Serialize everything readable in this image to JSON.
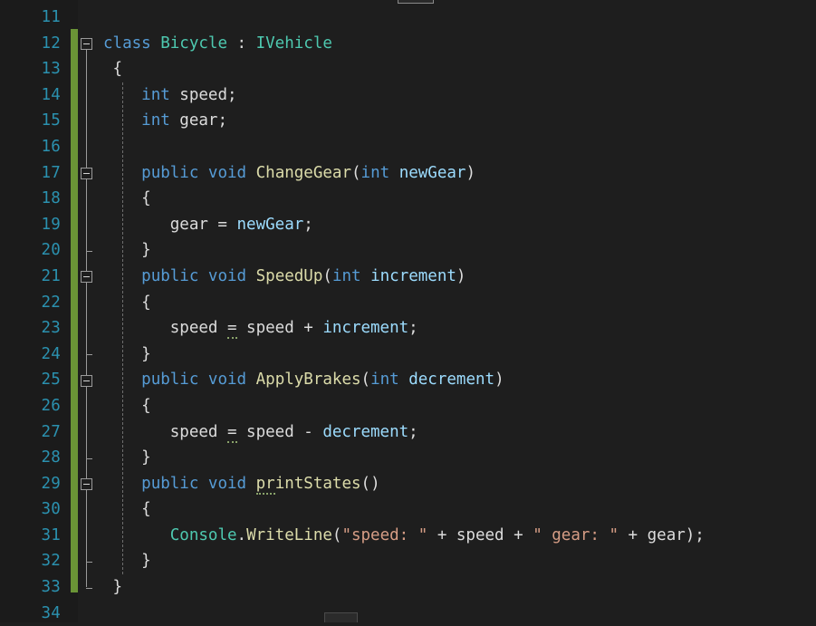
{
  "editor": {
    "language": "csharp",
    "first_visible_line": 11,
    "last_visible_line": 34,
    "colors": {
      "background": "#1e1e1e",
      "gutter_background": "#1b1b1b",
      "line_number": "#2b91af",
      "change_bar": "#6a9436",
      "keyword": "#569cd6",
      "type": "#4ec9b0",
      "method": "#dcdcaa",
      "parameter": "#9cdcfe",
      "string": "#d69d85",
      "plain": "#dcdcdc",
      "fold_marker": "#9a9a9a",
      "indent_guide": "#6e6e6e",
      "hint_underline": "#8aa36a"
    }
  },
  "line_numbers": [
    11,
    12,
    13,
    14,
    15,
    16,
    17,
    18,
    19,
    20,
    21,
    22,
    23,
    24,
    25,
    26,
    27,
    28,
    29,
    30,
    31,
    32,
    33,
    34
  ],
  "fold_markers": [
    {
      "line": 12,
      "state": "expanded",
      "glyph": "minus-box"
    },
    {
      "line": 17,
      "state": "expanded",
      "glyph": "minus-box"
    },
    {
      "line": 21,
      "state": "expanded",
      "glyph": "minus-box"
    },
    {
      "line": 25,
      "state": "expanded",
      "glyph": "minus-box"
    },
    {
      "line": 29,
      "state": "expanded",
      "glyph": "minus-box"
    }
  ],
  "code_lines": [
    {
      "n": 11,
      "tokens": []
    },
    {
      "n": 12,
      "tokens": [
        {
          "t": "class",
          "c": "kw"
        },
        {
          "t": " ",
          "c": "pln"
        },
        {
          "t": "Bicycle",
          "c": "type"
        },
        {
          "t": " : ",
          "c": "pln"
        },
        {
          "t": "IVehicle",
          "c": "type"
        }
      ]
    },
    {
      "n": 13,
      "tokens": [
        {
          "t": " {",
          "c": "pln"
        }
      ]
    },
    {
      "n": 14,
      "tokens": [
        {
          "t": "    ",
          "c": "pln"
        },
        {
          "t": "int",
          "c": "kw"
        },
        {
          "t": " speed;",
          "c": "pln"
        }
      ]
    },
    {
      "n": 15,
      "tokens": [
        {
          "t": "    ",
          "c": "pln"
        },
        {
          "t": "int",
          "c": "kw"
        },
        {
          "t": " gear;",
          "c": "pln"
        }
      ]
    },
    {
      "n": 16,
      "tokens": []
    },
    {
      "n": 17,
      "tokens": [
        {
          "t": "    ",
          "c": "pln"
        },
        {
          "t": "public",
          "c": "kw"
        },
        {
          "t": " ",
          "c": "pln"
        },
        {
          "t": "void",
          "c": "kw"
        },
        {
          "t": " ",
          "c": "pln"
        },
        {
          "t": "ChangeGear",
          "c": "mth"
        },
        {
          "t": "(",
          "c": "pln"
        },
        {
          "t": "int",
          "c": "kw"
        },
        {
          "t": " ",
          "c": "pln"
        },
        {
          "t": "newGear",
          "c": "par"
        },
        {
          "t": ")",
          "c": "pln"
        }
      ]
    },
    {
      "n": 18,
      "tokens": [
        {
          "t": "    {",
          "c": "pln"
        }
      ]
    },
    {
      "n": 19,
      "tokens": [
        {
          "t": "       gear = ",
          "c": "pln"
        },
        {
          "t": "newGear",
          "c": "par"
        },
        {
          "t": ";",
          "c": "pln"
        }
      ]
    },
    {
      "n": 20,
      "tokens": [
        {
          "t": "    }",
          "c": "pln"
        }
      ]
    },
    {
      "n": 21,
      "tokens": [
        {
          "t": "    ",
          "c": "pln"
        },
        {
          "t": "public",
          "c": "kw"
        },
        {
          "t": " ",
          "c": "pln"
        },
        {
          "t": "void",
          "c": "kw"
        },
        {
          "t": " ",
          "c": "pln"
        },
        {
          "t": "SpeedUp",
          "c": "mth"
        },
        {
          "t": "(",
          "c": "pln"
        },
        {
          "t": "int",
          "c": "kw"
        },
        {
          "t": " ",
          "c": "pln"
        },
        {
          "t": "increment",
          "c": "par"
        },
        {
          "t": ")",
          "c": "pln"
        }
      ]
    },
    {
      "n": 22,
      "tokens": [
        {
          "t": "    {",
          "c": "pln"
        }
      ]
    },
    {
      "n": 23,
      "tokens": [
        {
          "t": "       speed ",
          "c": "pln"
        },
        {
          "t": "=",
          "c": "pln",
          "hint": true
        },
        {
          "t": " speed + ",
          "c": "pln"
        },
        {
          "t": "increment",
          "c": "par"
        },
        {
          "t": ";",
          "c": "pln"
        }
      ]
    },
    {
      "n": 24,
      "tokens": [
        {
          "t": "    }",
          "c": "pln"
        }
      ]
    },
    {
      "n": 25,
      "tokens": [
        {
          "t": "    ",
          "c": "pln"
        },
        {
          "t": "public",
          "c": "kw"
        },
        {
          "t": " ",
          "c": "pln"
        },
        {
          "t": "void",
          "c": "kw"
        },
        {
          "t": " ",
          "c": "pln"
        },
        {
          "t": "ApplyBrakes",
          "c": "mth"
        },
        {
          "t": "(",
          "c": "pln"
        },
        {
          "t": "int",
          "c": "kw"
        },
        {
          "t": " ",
          "c": "pln"
        },
        {
          "t": "decrement",
          "c": "par"
        },
        {
          "t": ")",
          "c": "pln"
        }
      ]
    },
    {
      "n": 26,
      "tokens": [
        {
          "t": "    {",
          "c": "pln"
        }
      ]
    },
    {
      "n": 27,
      "tokens": [
        {
          "t": "       speed ",
          "c": "pln"
        },
        {
          "t": "=",
          "c": "pln",
          "hint": true
        },
        {
          "t": " speed - ",
          "c": "pln"
        },
        {
          "t": "decrement",
          "c": "par"
        },
        {
          "t": ";",
          "c": "pln"
        }
      ]
    },
    {
      "n": 28,
      "tokens": [
        {
          "t": "    }",
          "c": "pln"
        }
      ]
    },
    {
      "n": 29,
      "tokens": [
        {
          "t": "    ",
          "c": "pln"
        },
        {
          "t": "public",
          "c": "kw"
        },
        {
          "t": " ",
          "c": "pln"
        },
        {
          "t": "void",
          "c": "kw"
        },
        {
          "t": " ",
          "c": "pln"
        },
        {
          "t": "pr",
          "c": "mth",
          "hint": true
        },
        {
          "t": "intStates",
          "c": "mth"
        },
        {
          "t": "()",
          "c": "pln"
        }
      ]
    },
    {
      "n": 30,
      "tokens": [
        {
          "t": "    {",
          "c": "pln"
        }
      ]
    },
    {
      "n": 31,
      "tokens": [
        {
          "t": "       ",
          "c": "pln"
        },
        {
          "t": "Console",
          "c": "type"
        },
        {
          "t": ".",
          "c": "pln"
        },
        {
          "t": "WriteLine",
          "c": "mth"
        },
        {
          "t": "(",
          "c": "pln"
        },
        {
          "t": "\"speed: \"",
          "c": "str"
        },
        {
          "t": " + speed + ",
          "c": "pln"
        },
        {
          "t": "\" gear: \"",
          "c": "str"
        },
        {
          "t": " + gear);",
          "c": "pln"
        }
      ]
    },
    {
      "n": 32,
      "tokens": [
        {
          "t": "    }",
          "c": "pln"
        }
      ]
    },
    {
      "n": 33,
      "tokens": [
        {
          "t": " }",
          "c": "pln"
        }
      ]
    },
    {
      "n": 34,
      "tokens": []
    }
  ],
  "code_text": "class Bicycle : IVehicle\n {\n     int speed;\n     int gear;\n\n     public void ChangeGear(int newGear)\n     {\n        gear = newGear;\n     }\n     public void SpeedUp(int increment)\n     {\n        speed = speed + increment;\n     }\n     public void ApplyBrakes(int decrement)\n     {\n        speed = speed - decrement;\n     }\n     public void printStates()\n     {\n        Console.WriteLine(\"speed: \" + speed + \" gear: \" + gear);\n     }\n }",
  "collapsed_region_stubs": [
    {
      "position": "top",
      "label": ""
    },
    {
      "position": "bottom",
      "label": ""
    }
  ],
  "indent_guides": [
    {
      "from_line": 14,
      "to_line": 32
    }
  ]
}
